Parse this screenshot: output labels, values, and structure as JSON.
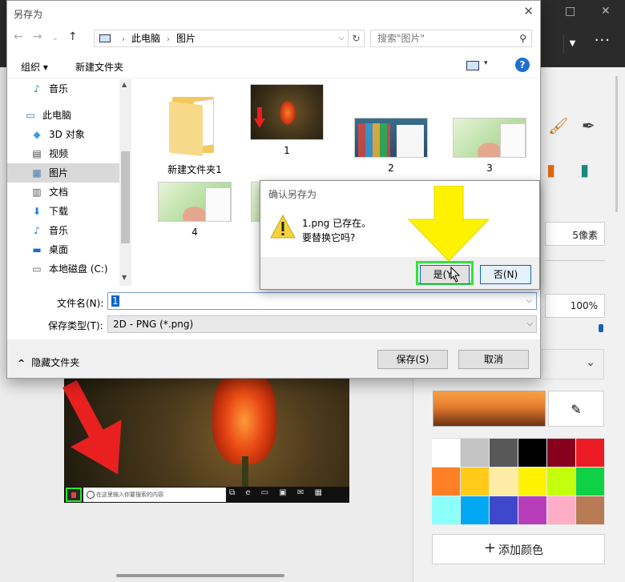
{
  "dialog": {
    "title": "另存为",
    "close_glyph": "✕",
    "nav": {
      "back": "←",
      "forward": "→",
      "recent": "⌄",
      "up": "↑"
    },
    "address": {
      "parts": [
        "此电脑",
        "图片"
      ],
      "sep": "›",
      "dropdown": "⌵",
      "refresh": "↻"
    },
    "search_placeholder": "搜索\"图片\"",
    "toolbar": {
      "organize": "组织 ▾",
      "new_folder": "新建文件夹",
      "view_dropdown": "▾",
      "help": "?"
    },
    "nav_items": [
      {
        "label": "音乐",
        "icon": "music-icon",
        "glyph": "♪",
        "color": "#1a7fd4"
      },
      {
        "label": "此电脑",
        "icon": "computer-icon",
        "glyph": "▭",
        "color": "#2a6fb0"
      },
      {
        "label": "3D 对象",
        "icon": "cube-icon",
        "glyph": "◆",
        "color": "#3aa0d8"
      },
      {
        "label": "视频",
        "icon": "video-icon",
        "glyph": "▤",
        "color": "#444444"
      },
      {
        "label": "图片",
        "icon": "pictures-icon",
        "glyph": "▦",
        "color": "#4a7ab0"
      },
      {
        "label": "文档",
        "icon": "document-icon",
        "glyph": "▥",
        "color": "#555555"
      },
      {
        "label": "下载",
        "icon": "download-icon",
        "glyph": "⬇",
        "color": "#1a7fd4"
      },
      {
        "label": "音乐",
        "icon": "music-icon",
        "glyph": "♪",
        "color": "#1a7fd4"
      },
      {
        "label": "桌面",
        "icon": "desktop-icon",
        "glyph": "▬",
        "color": "#1a6fc4"
      },
      {
        "label": "本地磁盘 (C:)",
        "icon": "disk-icon",
        "glyph": "▭",
        "color": "#555555"
      }
    ],
    "files": [
      {
        "name": "新建文件夹1"
      },
      {
        "name": "1"
      },
      {
        "name": "2"
      },
      {
        "name": "3"
      },
      {
        "name": "4"
      }
    ],
    "filename_label": "文件名(N):",
    "filename_value": "1",
    "filetype_label": "保存类型(T):",
    "filetype_value": "2D - PNG (*.png)",
    "hide_folders": "隐藏文件夹",
    "save_button": "保存(S)",
    "cancel_button": "取消"
  },
  "confirm": {
    "title": "确认另存为",
    "message_line1": "1.png 已存在。",
    "message_line2": "要替换它吗?",
    "yes_button": "是(Y)",
    "no_button": "否(N)"
  },
  "app": {
    "min_glyph": "—",
    "max_glyph": "□",
    "more": "···",
    "brush_size": "5像素",
    "opacity": "100%",
    "picker_glyph": "✎",
    "add_color": "添加颜色",
    "taskbar_search": "在这里输入你要搜索的内容",
    "taskbar_icons": "⧉ e ▭ ▣ ✉ ▦",
    "palette": [
      "#ffffff",
      "#c3c3c3",
      "#585858",
      "#000000",
      "#88001b",
      "#ec1c24",
      "#ff7f27",
      "#ffca18",
      "#fdeca6",
      "#fff200",
      "#c4ff0e",
      "#0ed145",
      "#8cfffb",
      "#00a8f3",
      "#3f48cc",
      "#b83dba",
      "#ffaec8",
      "#b97a56"
    ],
    "colors": {
      "accent_green": "#33e23a",
      "arrow_red": "#e82020",
      "arrow_yellow": "#fff200"
    }
  }
}
